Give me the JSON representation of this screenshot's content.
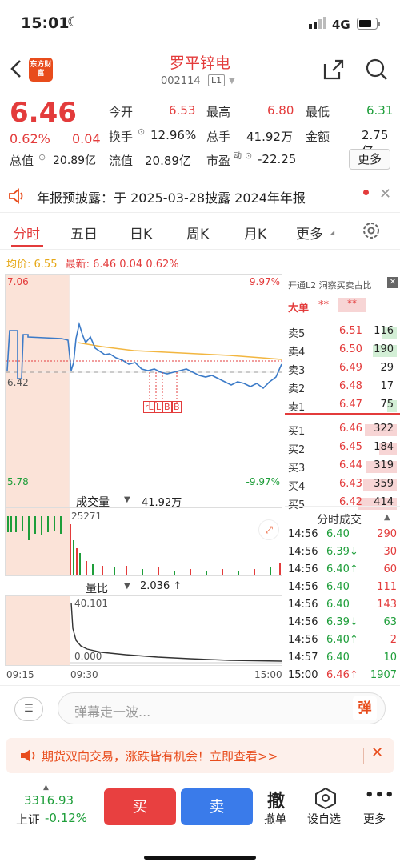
{
  "status": {
    "time": "15:01",
    "network": "4G"
  },
  "header": {
    "stock_name": "罗平锌电",
    "stock_code": "002114",
    "level": "L1",
    "logo_text": "东方财富"
  },
  "quote": {
    "price": "6.46",
    "change_pct": "0.62%",
    "change": "0.04",
    "open_label": "今开",
    "open": "6.53",
    "high_label": "最高",
    "high": "6.80",
    "low_label": "最低",
    "low": "6.31",
    "turnover_label": "换手",
    "turnover": "12.96%",
    "volume_label": "总手",
    "volume": "41.92万",
    "amount_label": "金额",
    "amount": "2.75亿",
    "mcap_label": "总值",
    "mcap": "20.89亿",
    "float_label": "流值",
    "float": "20.89亿",
    "pe_label": "市盈",
    "pe_sup": "动",
    "pe": "-22.25",
    "more": "更多"
  },
  "notice": {
    "text": "年报预披露：于 2025-03-28披露 2024年年报"
  },
  "tabs": [
    "分时",
    "五日",
    "日K",
    "周K",
    "月K",
    "更多",
    "settings"
  ],
  "chart": {
    "avg_label": "均价:",
    "avg": "6.55",
    "latest_label": "最新:",
    "latest": "6.46",
    "latest_chg": "0.04",
    "latest_pct": "0.62%",
    "y_top": "7.06",
    "y_top_pct": "9.97%",
    "y_mid": "6.42",
    "y_bot": "5.78",
    "y_bot_pct": "-9.97%",
    "markers": [
      "rL",
      "L",
      "B",
      "B"
    ],
    "vol_label": "成交量",
    "vol_value": "41.92万",
    "vol_peak": "25271",
    "ratio_label": "量比",
    "ratio_value": "2.036 ↑",
    "ratio_top": "40.101",
    "ratio_zero": "0.000",
    "time_start": "09:15",
    "time_mid": "09:30",
    "time_end": "15:00"
  },
  "chart_data": {
    "type": "line",
    "price_path_desc": "intraday",
    "ylim": [
      5.78,
      7.06
    ]
  },
  "orderbook": {
    "promo": "开通L2 洞察买卖占比",
    "big_label": "大单",
    "big_val1": "**",
    "big_val2": "**",
    "asks": [
      {
        "l": "卖5",
        "p": "6.51",
        "v": "116"
      },
      {
        "l": "卖4",
        "p": "6.50",
        "v": "190"
      },
      {
        "l": "卖3",
        "p": "6.49",
        "v": "29"
      },
      {
        "l": "卖2",
        "p": "6.48",
        "v": "17"
      },
      {
        "l": "卖1",
        "p": "6.47",
        "v": "75"
      }
    ],
    "bids": [
      {
        "l": "买1",
        "p": "6.46",
        "v": "322"
      },
      {
        "l": "买2",
        "p": "6.45",
        "v": "184"
      },
      {
        "l": "买3",
        "p": "6.44",
        "v": "319"
      },
      {
        "l": "买4",
        "p": "6.43",
        "v": "359"
      },
      {
        "l": "买5",
        "p": "6.42",
        "v": "414"
      }
    ]
  },
  "trades": {
    "title": "分时成交",
    "rows": [
      {
        "t": "14:56",
        "p": "6.40",
        "v": "290"
      },
      {
        "t": "14:56",
        "p": "6.39↓",
        "v": "30"
      },
      {
        "t": "14:56",
        "p": "6.40↑",
        "v": "60"
      },
      {
        "t": "14:56",
        "p": "6.40",
        "v": "111"
      },
      {
        "t": "14:56",
        "p": "6.40",
        "v": "143"
      },
      {
        "t": "14:56",
        "p": "6.39↓",
        "v": "63"
      },
      {
        "t": "14:56",
        "p": "6.40↑",
        "v": "2"
      },
      {
        "t": "14:57",
        "p": "6.40",
        "v": "10"
      },
      {
        "t": "15:00",
        "p": "6.46↑",
        "v": "1907"
      }
    ]
  },
  "comment": {
    "placeholder": "弹幕走一波...",
    "danmu": "弹"
  },
  "ad": {
    "text": "期货双向交易，涨跌皆有机会！立即查看>>"
  },
  "bottom": {
    "index_value": "3316.93",
    "index_name": "上证",
    "index_pct": "-0.12%",
    "buy": "买",
    "sell": "卖",
    "cancel_icon": "撤",
    "cancel": "撤单",
    "self": "设自选",
    "more": "更多"
  }
}
